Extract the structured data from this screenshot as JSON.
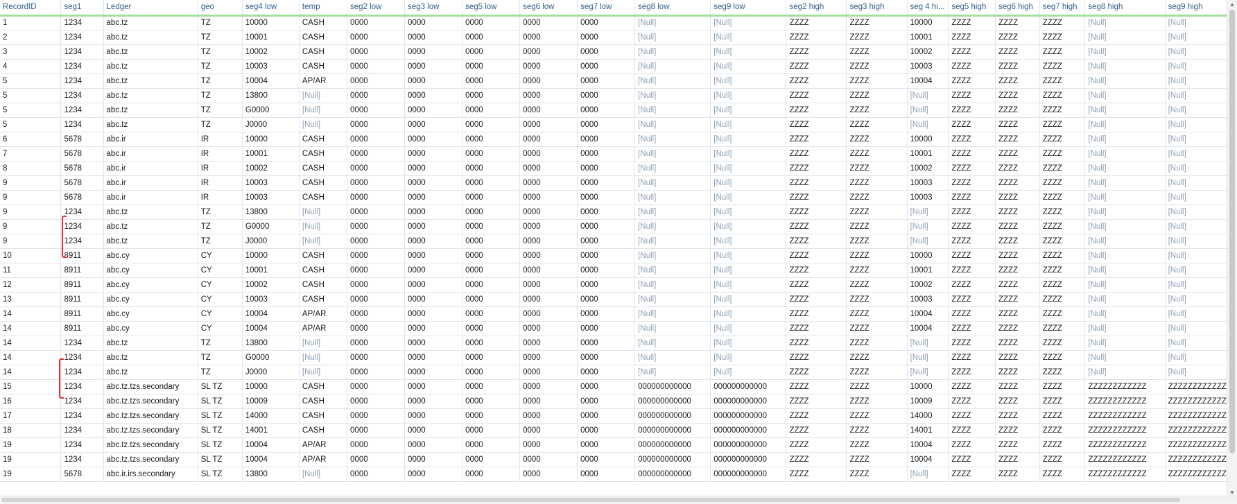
{
  "columns": [
    "RecordID",
    "seg1",
    "Ledger",
    "geo",
    "seg4 low",
    "temp",
    "seg2 low",
    "seg3 low",
    "seg5 low",
    "seg6 low",
    "seg7 low",
    "seg8 low",
    "seg9 low",
    "seg2 high",
    "seg3 high",
    "seg 4 hi...",
    "seg5 high",
    "seg6 high",
    "seg7 high",
    "seg8 high",
    "seg9 high"
  ],
  "null_text": "[Null]",
  "rows": [
    [
      "1",
      "1234",
      "abc.tz",
      "TZ",
      "10000",
      "CASH",
      "0000",
      "0000",
      "0000",
      "0000",
      "0000",
      "[Null]",
      "[Null]",
      "ZZZZ",
      "ZZZZ",
      "10000",
      "ZZZZ",
      "ZZZZ",
      "ZZZZ",
      "[Null]",
      "[Null]"
    ],
    [
      "2",
      "1234",
      "abc.tz",
      "TZ",
      "10001",
      "CASH",
      "0000",
      "0000",
      "0000",
      "0000",
      "0000",
      "[Null]",
      "[Null]",
      "ZZZZ",
      "ZZZZ",
      "10001",
      "ZZZZ",
      "ZZZZ",
      "ZZZZ",
      "[Null]",
      "[Null]"
    ],
    [
      "3",
      "1234",
      "abc.tz",
      "TZ",
      "10002",
      "CASH",
      "0000",
      "0000",
      "0000",
      "0000",
      "0000",
      "[Null]",
      "[Null]",
      "ZZZZ",
      "ZZZZ",
      "10002",
      "ZZZZ",
      "ZZZZ",
      "ZZZZ",
      "[Null]",
      "[Null]"
    ],
    [
      "4",
      "1234",
      "abc.tz",
      "TZ",
      "10003",
      "CASH",
      "0000",
      "0000",
      "0000",
      "0000",
      "0000",
      "[Null]",
      "[Null]",
      "ZZZZ",
      "ZZZZ",
      "10003",
      "ZZZZ",
      "ZZZZ",
      "ZZZZ",
      "[Null]",
      "[Null]"
    ],
    [
      "5",
      "1234",
      "abc.tz",
      "TZ",
      "10004",
      "AP/AR",
      "0000",
      "0000",
      "0000",
      "0000",
      "0000",
      "[Null]",
      "[Null]",
      "ZZZZ",
      "ZZZZ",
      "10004",
      "ZZZZ",
      "ZZZZ",
      "ZZZZ",
      "[Null]",
      "[Null]"
    ],
    [
      "5",
      "1234",
      "abc.tz",
      "TZ",
      "13800",
      "[Null]",
      "0000",
      "0000",
      "0000",
      "0000",
      "0000",
      "[Null]",
      "[Null]",
      "ZZZZ",
      "ZZZZ",
      "[Null]",
      "ZZZZ",
      "ZZZZ",
      "ZZZZ",
      "[Null]",
      "[Null]"
    ],
    [
      "5",
      "1234",
      "abc.tz",
      "TZ",
      "G0000",
      "[Null]",
      "0000",
      "0000",
      "0000",
      "0000",
      "0000",
      "[Null]",
      "[Null]",
      "ZZZZ",
      "ZZZZ",
      "[Null]",
      "ZZZZ",
      "ZZZZ",
      "ZZZZ",
      "[Null]",
      "[Null]"
    ],
    [
      "5",
      "1234",
      "abc.tz",
      "TZ",
      "J0000",
      "[Null]",
      "0000",
      "0000",
      "0000",
      "0000",
      "0000",
      "[Null]",
      "[Null]",
      "ZZZZ",
      "ZZZZ",
      "[Null]",
      "ZZZZ",
      "ZZZZ",
      "ZZZZ",
      "[Null]",
      "[Null]"
    ],
    [
      "6",
      "5678",
      "abc.ir",
      "IR",
      "10000",
      "CASH",
      "0000",
      "0000",
      "0000",
      "0000",
      "0000",
      "[Null]",
      "[Null]",
      "ZZZZ",
      "ZZZZ",
      "10000",
      "ZZZZ",
      "ZZZZ",
      "ZZZZ",
      "[Null]",
      "[Null]"
    ],
    [
      "7",
      "5678",
      "abc.ir",
      "IR",
      "10001",
      "CASH",
      "0000",
      "0000",
      "0000",
      "0000",
      "0000",
      "[Null]",
      "[Null]",
      "ZZZZ",
      "ZZZZ",
      "10001",
      "ZZZZ",
      "ZZZZ",
      "ZZZZ",
      "[Null]",
      "[Null]"
    ],
    [
      "8",
      "5678",
      "abc.ir",
      "IR",
      "10002",
      "CASH",
      "0000",
      "0000",
      "0000",
      "0000",
      "0000",
      "[Null]",
      "[Null]",
      "ZZZZ",
      "ZZZZ",
      "10002",
      "ZZZZ",
      "ZZZZ",
      "ZZZZ",
      "[Null]",
      "[Null]"
    ],
    [
      "9",
      "5678",
      "abc.ir",
      "IR",
      "10003",
      "CASH",
      "0000",
      "0000",
      "0000",
      "0000",
      "0000",
      "[Null]",
      "[Null]",
      "ZZZZ",
      "ZZZZ",
      "10003",
      "ZZZZ",
      "ZZZZ",
      "ZZZZ",
      "[Null]",
      "[Null]"
    ],
    [
      "9",
      "5678",
      "abc.ir",
      "IR",
      "10003",
      "CASH",
      "0000",
      "0000",
      "0000",
      "0000",
      "0000",
      "[Null]",
      "[Null]",
      "ZZZZ",
      "ZZZZ",
      "10003",
      "ZZZZ",
      "ZZZZ",
      "ZZZZ",
      "[Null]",
      "[Null]"
    ],
    [
      "9",
      "1234",
      "abc.tz",
      "TZ",
      "13800",
      "[Null]",
      "0000",
      "0000",
      "0000",
      "0000",
      "0000",
      "[Null]",
      "[Null]",
      "ZZZZ",
      "ZZZZ",
      "[Null]",
      "ZZZZ",
      "ZZZZ",
      "ZZZZ",
      "[Null]",
      "[Null]"
    ],
    [
      "9",
      "1234",
      "abc.tz",
      "TZ",
      "G0000",
      "[Null]",
      "0000",
      "0000",
      "0000",
      "0000",
      "0000",
      "[Null]",
      "[Null]",
      "ZZZZ",
      "ZZZZ",
      "[Null]",
      "ZZZZ",
      "ZZZZ",
      "ZZZZ",
      "[Null]",
      "[Null]"
    ],
    [
      "9",
      "1234",
      "abc.tz",
      "TZ",
      "J0000",
      "[Null]",
      "0000",
      "0000",
      "0000",
      "0000",
      "0000",
      "[Null]",
      "[Null]",
      "ZZZZ",
      "ZZZZ",
      "[Null]",
      "ZZZZ",
      "ZZZZ",
      "ZZZZ",
      "[Null]",
      "[Null]"
    ],
    [
      "10",
      "8911",
      "abc.cy",
      "CY",
      "10000",
      "CASH",
      "0000",
      "0000",
      "0000",
      "0000",
      "0000",
      "[Null]",
      "[Null]",
      "ZZZZ",
      "ZZZZ",
      "10000",
      "ZZZZ",
      "ZZZZ",
      "ZZZZ",
      "[Null]",
      "[Null]"
    ],
    [
      "11",
      "8911",
      "abc.cy",
      "CY",
      "10001",
      "CASH",
      "0000",
      "0000",
      "0000",
      "0000",
      "0000",
      "[Null]",
      "[Null]",
      "ZZZZ",
      "ZZZZ",
      "10001",
      "ZZZZ",
      "ZZZZ",
      "ZZZZ",
      "[Null]",
      "[Null]"
    ],
    [
      "12",
      "8911",
      "abc.cy",
      "CY",
      "10002",
      "CASH",
      "0000",
      "0000",
      "0000",
      "0000",
      "0000",
      "[Null]",
      "[Null]",
      "ZZZZ",
      "ZZZZ",
      "10002",
      "ZZZZ",
      "ZZZZ",
      "ZZZZ",
      "[Null]",
      "[Null]"
    ],
    [
      "13",
      "8911",
      "abc.cy",
      "CY",
      "10003",
      "CASH",
      "0000",
      "0000",
      "0000",
      "0000",
      "0000",
      "[Null]",
      "[Null]",
      "ZZZZ",
      "ZZZZ",
      "10003",
      "ZZZZ",
      "ZZZZ",
      "ZZZZ",
      "[Null]",
      "[Null]"
    ],
    [
      "14",
      "8911",
      "abc.cy",
      "CY",
      "10004",
      "AP/AR",
      "0000",
      "0000",
      "0000",
      "0000",
      "0000",
      "[Null]",
      "[Null]",
      "ZZZZ",
      "ZZZZ",
      "10004",
      "ZZZZ",
      "ZZZZ",
      "ZZZZ",
      "[Null]",
      "[Null]"
    ],
    [
      "14",
      "8911",
      "abc.cy",
      "CY",
      "10004",
      "AP/AR",
      "0000",
      "0000",
      "0000",
      "0000",
      "0000",
      "[Null]",
      "[Null]",
      "ZZZZ",
      "ZZZZ",
      "10004",
      "ZZZZ",
      "ZZZZ",
      "ZZZZ",
      "[Null]",
      "[Null]"
    ],
    [
      "14",
      "1234",
      "abc.tz",
      "TZ",
      "13800",
      "[Null]",
      "0000",
      "0000",
      "0000",
      "0000",
      "0000",
      "[Null]",
      "[Null]",
      "ZZZZ",
      "ZZZZ",
      "[Null]",
      "ZZZZ",
      "ZZZZ",
      "ZZZZ",
      "[Null]",
      "[Null]"
    ],
    [
      "14",
      "1234",
      "abc.tz",
      "TZ",
      "G0000",
      "[Null]",
      "0000",
      "0000",
      "0000",
      "0000",
      "0000",
      "[Null]",
      "[Null]",
      "ZZZZ",
      "ZZZZ",
      "[Null]",
      "ZZZZ",
      "ZZZZ",
      "ZZZZ",
      "[Null]",
      "[Null]"
    ],
    [
      "14",
      "1234",
      "abc.tz",
      "TZ",
      "J0000",
      "[Null]",
      "0000",
      "0000",
      "0000",
      "0000",
      "0000",
      "[Null]",
      "[Null]",
      "ZZZZ",
      "ZZZZ",
      "[Null]",
      "ZZZZ",
      "ZZZZ",
      "ZZZZ",
      "[Null]",
      "[Null]"
    ],
    [
      "15",
      "1234",
      "abc.tz.tzs.secondary",
      "SL TZ",
      "10000",
      "CASH",
      "0000",
      "0000",
      "0000",
      "0000",
      "0000",
      "000000000000",
      "000000000000",
      "ZZZZ",
      "ZZZZ",
      "10000",
      "ZZZZ",
      "ZZZZ",
      "ZZZZ",
      "ZZZZZZZZZZZZ",
      "ZZZZZZZZZZZZ"
    ],
    [
      "16",
      "1234",
      "abc.tz.tzs.secondary",
      "SL TZ",
      "10009",
      "CASH",
      "0000",
      "0000",
      "0000",
      "0000",
      "0000",
      "000000000000",
      "000000000000",
      "ZZZZ",
      "ZZZZ",
      "10009",
      "ZZZZ",
      "ZZZZ",
      "ZZZZ",
      "ZZZZZZZZZZZZ",
      "ZZZZZZZZZZZZ"
    ],
    [
      "17",
      "1234",
      "abc.tz.tzs.secondary",
      "SL TZ",
      "14000",
      "CASH",
      "0000",
      "0000",
      "0000",
      "0000",
      "0000",
      "000000000000",
      "000000000000",
      "ZZZZ",
      "ZZZZ",
      "14000",
      "ZZZZ",
      "ZZZZ",
      "ZZZZ",
      "ZZZZZZZZZZZZ",
      "ZZZZZZZZZZZZ"
    ],
    [
      "18",
      "1234",
      "abc.tz.tzs.secondary",
      "SL TZ",
      "14001",
      "CASH",
      "0000",
      "0000",
      "0000",
      "0000",
      "0000",
      "000000000000",
      "000000000000",
      "ZZZZ",
      "ZZZZ",
      "14001",
      "ZZZZ",
      "ZZZZ",
      "ZZZZ",
      "ZZZZZZZZZZZZ",
      "ZZZZZZZZZZZZ"
    ],
    [
      "19",
      "1234",
      "abc.tz.tzs.secondary",
      "SL TZ",
      "10004",
      "AP/AR",
      "0000",
      "0000",
      "0000",
      "0000",
      "0000",
      "000000000000",
      "000000000000",
      "ZZZZ",
      "ZZZZ",
      "10004",
      "ZZZZ",
      "ZZZZ",
      "ZZZZ",
      "ZZZZZZZZZZZZ",
      "ZZZZZZZZZZZZ"
    ],
    [
      "19",
      "1234",
      "abc.tz.tzs.secondary",
      "SL TZ",
      "10004",
      "AP/AR",
      "0000",
      "0000",
      "0000",
      "0000",
      "0000",
      "000000000000",
      "000000000000",
      "ZZZZ",
      "ZZZZ",
      "10004",
      "ZZZZ",
      "ZZZZ",
      "ZZZZ",
      "ZZZZZZZZZZZZ",
      "ZZZZZZZZZZZZ"
    ],
    [
      "19",
      "5678",
      "abc.ir.irs.secondary",
      "SL TZ",
      "13800",
      "[Null]",
      "0000",
      "0000",
      "0000",
      "0000",
      "0000",
      "000000000000",
      "000000000000",
      "ZZZZ",
      "ZZZZ",
      "[Null]",
      "ZZZZ",
      "ZZZZ",
      "ZZZZ",
      "ZZZZZZZZZZZZ",
      "ZZZZZZZZZZZZ"
    ]
  ],
  "annotation_color": "#e0312b",
  "header_accent_color": "#9fe09a",
  "header_partial_accent_color": "#f5c542",
  "null_color": "#8ea0b5",
  "icons": {
    "scroll_up": "chevron-up-icon",
    "scroll_down": "chevron-down-icon"
  }
}
